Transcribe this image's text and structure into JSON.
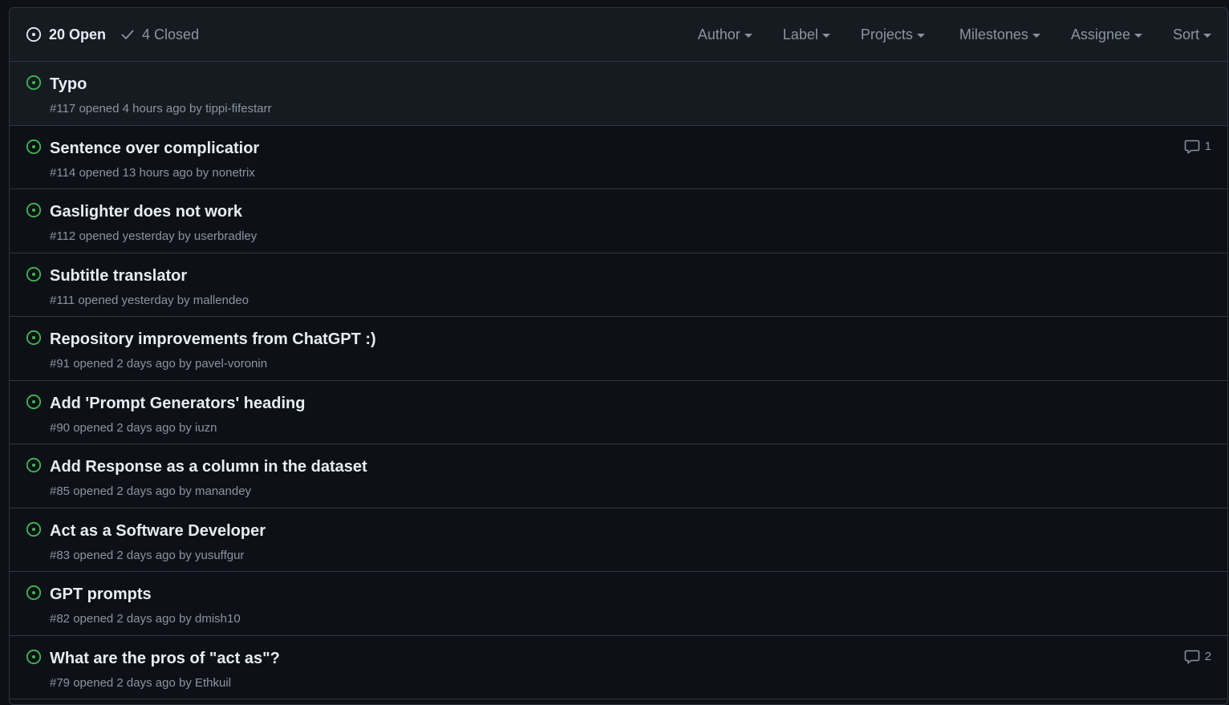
{
  "header": {
    "open_label": "20 Open",
    "closed_label": "4 Closed",
    "filters": [
      "Author",
      "Label",
      "Projects",
      "Milestones",
      "Assignee",
      "Sort"
    ]
  },
  "issues": [
    {
      "title": "Typo",
      "number": "#117",
      "opened": "opened 4 hours ago by",
      "author": "tippi-fifestarr",
      "comments": ""
    },
    {
      "title": "Sentence over complicatior",
      "number": "#114",
      "opened": "opened 13 hours ago by",
      "author": "nonetrix",
      "comments": "1"
    },
    {
      "title": "Gaslighter does not work",
      "number": "#112",
      "opened": "opened yesterday by",
      "author": "userbradley",
      "comments": ""
    },
    {
      "title": "Subtitle translator",
      "number": "#111",
      "opened": "opened yesterday by",
      "author": "mallendeo",
      "comments": ""
    },
    {
      "title": "Repository improvements from ChatGPT :)",
      "number": "#91",
      "opened": "opened 2 days ago by",
      "author": "pavel-voronin",
      "comments": ""
    },
    {
      "title": "Add 'Prompt Generators' heading",
      "number": "#90",
      "opened": "opened 2 days ago by",
      "author": "iuzn",
      "comments": ""
    },
    {
      "title": "Add Response as a column in the dataset",
      "number": "#85",
      "opened": "opened 2 days ago by",
      "author": "manandey",
      "comments": ""
    },
    {
      "title": "Act as a Software Developer",
      "number": "#83",
      "opened": "opened 2 days ago by",
      "author": "yusuffgur",
      "comments": ""
    },
    {
      "title": "GPT prompts",
      "number": "#82",
      "opened": "opened 2 days ago by",
      "author": "dmish10",
      "comments": ""
    },
    {
      "title": "What are the pros of \"act as\"?",
      "number": "#79",
      "opened": "opened 2 days ago by",
      "author": "Ethkuil",
      "comments": "2"
    }
  ],
  "colors": {
    "background": "#0d1117",
    "header_bg": "#161b22",
    "border": "#30363d",
    "open_icon": "#3fb950",
    "muted_text": "#8b949e",
    "title_text": "#e6edf3"
  },
  "icons": {
    "open_state": "issue-opened-icon",
    "closed_state": "check-icon",
    "comments": "comment-icon",
    "dropdown": "caret-down-icon"
  }
}
